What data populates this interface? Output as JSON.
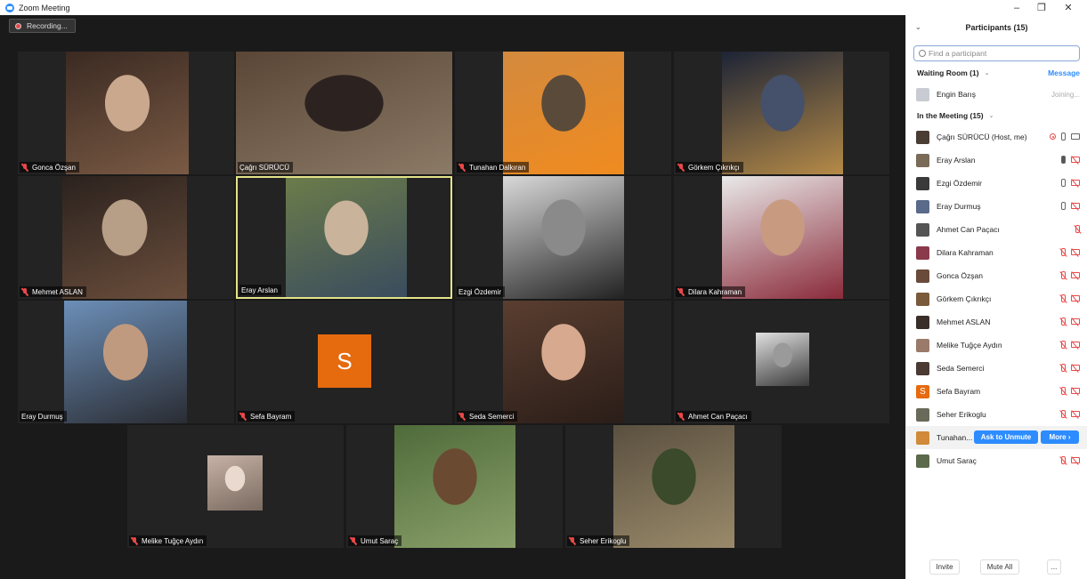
{
  "window": {
    "title": "Zoom Meeting",
    "minimize": "–",
    "restore": "❐",
    "close": "✕"
  },
  "recording": {
    "label": "Recording..."
  },
  "tiles": [
    {
      "name": "Gonca Özşan",
      "muted": true,
      "photo_colors": [
        "#3b2a22",
        "#7a5a44",
        "#c9a88e"
      ]
    },
    {
      "name": "Çağrı SÜRÜCÜ",
      "muted": false,
      "photo_colors": [
        "#5a4636",
        "#8b7a66",
        "#2c2320"
      ]
    },
    {
      "name": "Tunahan Dalkıran",
      "muted": true,
      "photo_colors": [
        "#d38a3e",
        "#f08b1f",
        "#5a4a3a"
      ]
    },
    {
      "name": "Görkem Çıkrıkçı",
      "muted": true,
      "photo_colors": [
        "#1d2436",
        "#b58a47",
        "#45506a"
      ]
    },
    {
      "name": "Mehmet ASLAN",
      "muted": true,
      "photo_colors": [
        "#2b221e",
        "#6b4e3c",
        "#b79e86"
      ]
    },
    {
      "name": "Eray Arslan",
      "muted": false,
      "photo_colors": [
        "#6b7c4a",
        "#3a4c5e",
        "#c9b39a"
      ]
    },
    {
      "name": "Ezgi Özdemir",
      "muted": false,
      "photo_colors": [
        "#d9d9d9",
        "#222222",
        "#8a8a8a"
      ]
    },
    {
      "name": "Dilara Kahraman",
      "muted": true,
      "photo_colors": [
        "#e9e9e9",
        "#8a2a3a",
        "#c89a80"
      ]
    },
    {
      "name": "Eray Durmuş",
      "muted": false,
      "photo_colors": [
        "#6c8fb8",
        "#2a2c33",
        "#c09a7e"
      ]
    },
    {
      "name": "Sefa Bayram",
      "muted": true,
      "avatar_letter": "S"
    },
    {
      "name": "Seda Semerci",
      "muted": true,
      "photo_colors": [
        "#5a3e30",
        "#2a1d18",
        "#d7a98e"
      ]
    },
    {
      "name": "Ahmet Can Paçacı",
      "muted": true,
      "photo_colors": [
        "#e0e0e0",
        "#3a3a3a",
        "#9a9a9a"
      ]
    },
    {
      "name": "Melike Tuğçe Aydın",
      "muted": true,
      "photo_colors": [
        "#c7b2a6",
        "#7a6a60",
        "#e9d9cf"
      ]
    },
    {
      "name": "Umut Saraç",
      "muted": true,
      "photo_colors": [
        "#4f6b3a",
        "#8aa06a",
        "#6b4a32"
      ]
    },
    {
      "name": "Seher Erikoglu",
      "muted": true,
      "photo_colors": [
        "#5a5040",
        "#9a8a6a",
        "#3a4a2a"
      ]
    }
  ],
  "panel": {
    "title": "Participants (15)",
    "search_placeholder": "Find a participant",
    "waiting_room": {
      "label": "Waiting Room (1)",
      "message_label": "Message"
    },
    "waiting": [
      {
        "name": "Engin Barış",
        "status": "Joining...",
        "color": "#c8ccd2"
      }
    ],
    "in_meeting_label": "In the Meeting (15)",
    "participants": [
      {
        "name": "Çağrı SÜRÜCÜ (Host, me)",
        "color": "#4a3d34",
        "icons": "host"
      },
      {
        "name": "Eray Arslan",
        "color": "#7a6a58",
        "icons": "mic-on-cam-off"
      },
      {
        "name": "Ezgi Özdemir",
        "color": "#3a3a3a",
        "icons": "mic-cam-off"
      },
      {
        "name": "Eray Durmuş",
        "color": "#5a6a8a",
        "icons": "mic-cam-off"
      },
      {
        "name": "Ahmet Can Paçacı",
        "color": "#555555",
        "icons": "muted-only"
      },
      {
        "name": "Dilara Kahraman",
        "color": "#8a3a4a",
        "icons": "muted-cam-off"
      },
      {
        "name": "Gonca Özşan",
        "color": "#6a4a3a",
        "icons": "muted-cam-off"
      },
      {
        "name": "Görkem Çıkrıkçı",
        "color": "#7a5a3a",
        "icons": "muted-cam-off"
      },
      {
        "name": "Mehmet ASLAN",
        "color": "#3a2e28",
        "icons": "muted-cam-off"
      },
      {
        "name": "Melike Tuğçe Aydın",
        "color": "#9a7a6a",
        "icons": "muted-cam-off"
      },
      {
        "name": "Seda Semerci",
        "color": "#4a3a32",
        "icons": "muted-cam-off"
      },
      {
        "name": "Sefa Bayram",
        "color": "#e66a0e",
        "icons": "muted-cam-off",
        "letter": "S"
      },
      {
        "name": "Seher Erikoglu",
        "color": "#6a6a5a",
        "icons": "muted-cam-off"
      },
      {
        "name": "Tunahan...",
        "color": "#d08a3a",
        "icons": "hover"
      },
      {
        "name": "Umut Saraç",
        "color": "#5a6a4a",
        "icons": "muted-cam-off"
      }
    ],
    "ask_to_unmute": "Ask to Unmute",
    "more": "More ›",
    "footer": {
      "invite": "Invite",
      "mute_all": "Mute All",
      "more": "..."
    }
  }
}
